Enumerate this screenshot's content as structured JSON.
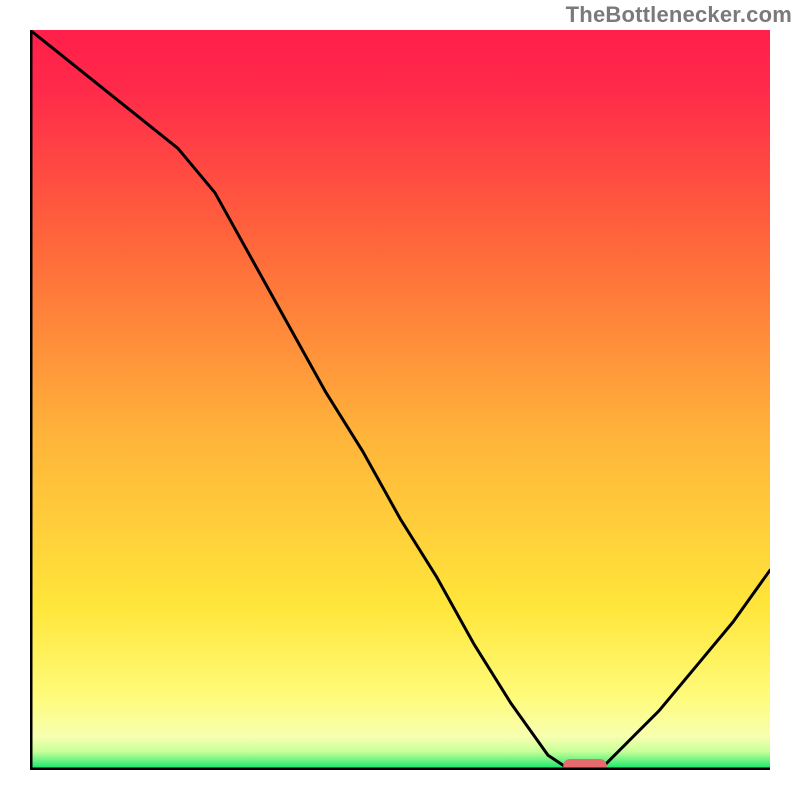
{
  "attribution": "TheBottlenecker.com",
  "colors": {
    "gradient_top": "#ff1f4a",
    "gradient_mid": "#fff23a",
    "gradient_bottom": "#00e46a",
    "axis": "#000000",
    "line": "#000000",
    "marker_fill": "#e76a6f",
    "marker_stroke": "#c9595e"
  },
  "chart_data": {
    "type": "line",
    "title": "",
    "xlabel": "",
    "ylabel": "",
    "xlim": [
      0,
      100
    ],
    "ylim": [
      0,
      100
    ],
    "grid": false,
    "legend": false,
    "comment": "Bottleneck-style curve; y=100 at x=0 dropping to y≈0 valley around x≈72-77, rising back toward x=100. Values are readouts of the visible curve height as a percentage of the plot box.",
    "x": [
      0,
      5,
      10,
      15,
      20,
      25,
      30,
      35,
      40,
      45,
      50,
      55,
      60,
      65,
      70,
      73,
      77,
      80,
      85,
      90,
      95,
      100
    ],
    "values": [
      100,
      96,
      92,
      88,
      84,
      78,
      69,
      60,
      51,
      43,
      34,
      26,
      17,
      9,
      2,
      0,
      0,
      3,
      8,
      14,
      20,
      27
    ],
    "marker": {
      "x_start": 73,
      "x_end": 77,
      "y": 0
    }
  }
}
